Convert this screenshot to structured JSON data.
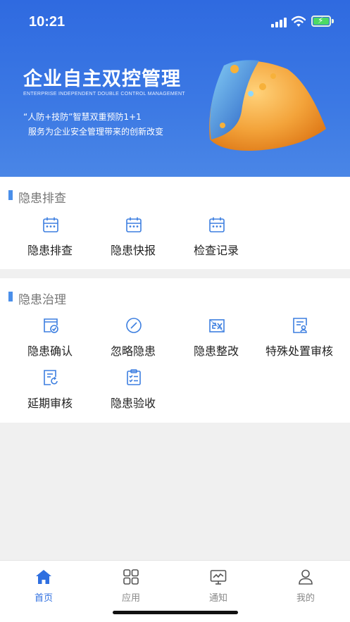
{
  "status_bar": {
    "time": "10:21"
  },
  "banner": {
    "title": "企业自主双控管理",
    "subtitle_en": "ENTERPRISE INDEPENDENT DOUBLE CONTROL MANAGEMENT",
    "line1": "“人防+技防”智慧双重预防1+1",
    "line2": "服务为企业安全管理带来的创新改变"
  },
  "section_inspection": {
    "title": "隐患排查",
    "items": [
      {
        "label": "隐患排查",
        "icon": "calendar-icon"
      },
      {
        "label": "隐患快报",
        "icon": "calendar-icon"
      },
      {
        "label": "检查记录",
        "icon": "calendar-icon"
      }
    ]
  },
  "section_governance": {
    "title": "隐患治理",
    "items": [
      {
        "label": "隐患确认",
        "icon": "confirm-icon"
      },
      {
        "label": "忽略隐患",
        "icon": "ignore-icon"
      },
      {
        "label": "隐患整改",
        "icon": "rectify-icon"
      },
      {
        "label": "特殊处置审核",
        "icon": "special-review-icon"
      },
      {
        "label": "延期审核",
        "icon": "extension-review-icon"
      },
      {
        "label": "隐患验收",
        "icon": "acceptance-icon"
      }
    ]
  },
  "tabbar": {
    "items": [
      {
        "label": "首页",
        "icon": "home-icon",
        "active": true
      },
      {
        "label": "应用",
        "icon": "apps-grid-icon",
        "active": false
      },
      {
        "label": "通知",
        "icon": "monitor-icon",
        "active": false
      },
      {
        "label": "我的",
        "icon": "user-icon",
        "active": false
      }
    ]
  },
  "colors": {
    "accent": "#2f6fe0",
    "banner": "#3c79e4",
    "icon": "#3d7fe0",
    "section_bar": "#4a8fea"
  }
}
